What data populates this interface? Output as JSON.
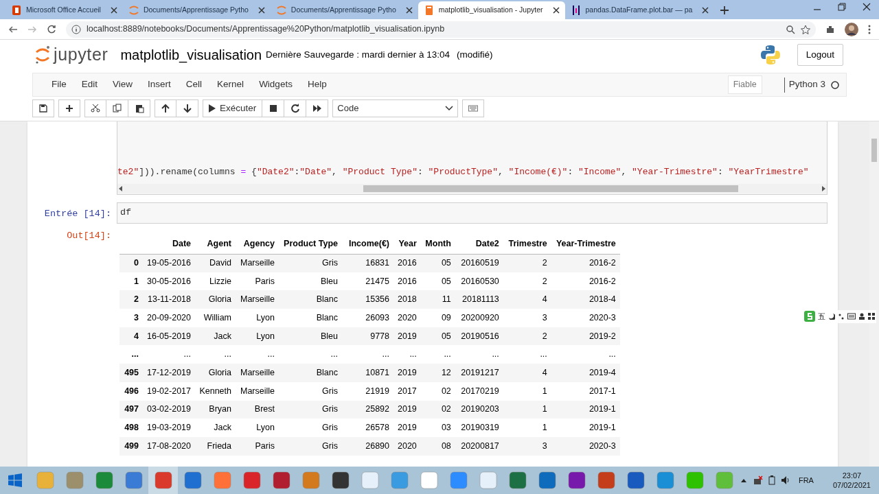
{
  "browser": {
    "tabs": [
      {
        "label": "Microsoft Office Accueil",
        "selected": false,
        "kind": "office"
      },
      {
        "label": "Documents/Apprentissage Pytho",
        "selected": false,
        "kind": "jupyter"
      },
      {
        "label": "Documents/Apprentissage Pytho",
        "selected": false,
        "kind": "jupyter"
      },
      {
        "label": "matplotlib_visualisation - Jupyter",
        "selected": true,
        "kind": "notebook"
      },
      {
        "label": "pandas.DataFrame.plot.bar — pa",
        "selected": false,
        "kind": "pandas"
      }
    ],
    "url": "localhost:8889/notebooks/Documents/Apprentissage%20Python/matplotlib_visualisation.ipynb"
  },
  "header": {
    "logo": "jupyter",
    "notebook_name": "matplotlib_visualisation",
    "checkpoint": "Dernière Sauvegarde : mardi dernier à 13:04",
    "modified": "(modifié)",
    "logout": "Logout"
  },
  "menu": [
    "File",
    "Edit",
    "View",
    "Insert",
    "Cell",
    "Kernel",
    "Widgets",
    "Help"
  ],
  "trusted": "Fiable",
  "kernel": "Python 3",
  "toolbar": {
    "run": "Exécuter",
    "cell_type": "Code"
  },
  "cells": [
    {
      "kind": "code_tail",
      "tokens": [
        {
          "text": "te2\"",
          "kind": "string"
        },
        {
          "text": "])).rename(columns ",
          "kind": "plain"
        },
        {
          "text": "=",
          "kind": "operator"
        },
        {
          "text": " {",
          "kind": "plain"
        },
        {
          "text": "\"Date2\"",
          "kind": "string"
        },
        {
          "text": ":",
          "kind": "plain"
        },
        {
          "text": "\"Date\"",
          "kind": "string"
        },
        {
          "text": ", ",
          "kind": "plain"
        },
        {
          "text": "\"Product Type\"",
          "kind": "string"
        },
        {
          "text": ": ",
          "kind": "plain"
        },
        {
          "text": "\"ProductType\"",
          "kind": "string"
        },
        {
          "text": ", ",
          "kind": "plain"
        },
        {
          "text": "\"Income(€)\"",
          "kind": "string"
        },
        {
          "text": ": ",
          "kind": "plain"
        },
        {
          "text": "\"Income\"",
          "kind": "string"
        },
        {
          "text": ", ",
          "kind": "plain"
        },
        {
          "text": "\"Year-Trimestre\"",
          "kind": "string"
        },
        {
          "text": ": ",
          "kind": "plain"
        },
        {
          "text": "\"YearTrimestre\"",
          "kind": "string"
        }
      ]
    },
    {
      "kind": "code",
      "prompt": "Entrée [14]:",
      "source": "df"
    },
    {
      "kind": "output",
      "prompt": "Out[14]:",
      "table": {
        "columns": [
          "",
          "Date",
          "Agent",
          "Agency",
          "Product Type",
          "Income(€)",
          "Year",
          "Month",
          "Date2",
          "Trimestre",
          "Year-Trimestre"
        ],
        "rows": [
          [
            "0",
            "19-05-2016",
            "David",
            "Marseille",
            "Gris",
            "16831",
            "2016",
            "05",
            "20160519",
            "2",
            "2016-2"
          ],
          [
            "1",
            "30-05-2016",
            "Lizzie",
            "Paris",
            "Bleu",
            "21475",
            "2016",
            "05",
            "20160530",
            "2",
            "2016-2"
          ],
          [
            "2",
            "13-11-2018",
            "Gloria",
            "Marseille",
            "Blanc",
            "15356",
            "2018",
            "11",
            "20181113",
            "4",
            "2018-4"
          ],
          [
            "3",
            "20-09-2020",
            "William",
            "Lyon",
            "Blanc",
            "26093",
            "2020",
            "09",
            "20200920",
            "3",
            "2020-3"
          ],
          [
            "4",
            "16-05-2019",
            "Jack",
            "Lyon",
            "Bleu",
            "9778",
            "2019",
            "05",
            "20190516",
            "2",
            "2019-2"
          ],
          [
            "...",
            "...",
            "...",
            "...",
            "...",
            "...",
            "...",
            "...",
            "...",
            "...",
            "..."
          ],
          [
            "495",
            "17-12-2019",
            "Gloria",
            "Marseille",
            "Blanc",
            "10871",
            "2019",
            "12",
            "20191217",
            "4",
            "2019-4"
          ],
          [
            "496",
            "19-02-2017",
            "Kenneth",
            "Marseille",
            "Gris",
            "21919",
            "2017",
            "02",
            "20170219",
            "1",
            "2017-1"
          ],
          [
            "497",
            "03-02-2019",
            "Bryan",
            "Brest",
            "Gris",
            "25892",
            "2019",
            "02",
            "20190203",
            "1",
            "2019-1"
          ],
          [
            "498",
            "19-03-2019",
            "Jack",
            "Lyon",
            "Gris",
            "26578",
            "2019",
            "03",
            "20190319",
            "1",
            "2019-1"
          ],
          [
            "499",
            "17-08-2020",
            "Frieda",
            "Paris",
            "Gris",
            "26890",
            "2020",
            "08",
            "20200817",
            "3",
            "2020-3"
          ]
        ]
      }
    }
  ],
  "ime": {
    "label": "五"
  },
  "taskbar": {
    "apps": [
      {
        "color": "#e8b23a",
        "selected": false
      },
      {
        "color": "#9c8f6b",
        "selected": false
      },
      {
        "color": "#1b8a3a",
        "selected": false
      },
      {
        "color": "#3a7bd5",
        "selected": false
      },
      {
        "color": "#d93a2b",
        "selected": true
      },
      {
        "color": "#1f6fd1",
        "selected": false
      },
      {
        "color": "#ff7139",
        "selected": false
      },
      {
        "color": "#d9252a",
        "selected": false
      },
      {
        "color": "#b01e2f",
        "selected": false
      },
      {
        "color": "#d47a1e",
        "selected": false
      },
      {
        "color": "#333333",
        "selected": false
      },
      {
        "color": "#e6f0fa",
        "selected": false
      },
      {
        "color": "#3b9be0",
        "selected": false
      },
      {
        "color": "#ffffff",
        "selected": false
      },
      {
        "color": "#2d8cff",
        "selected": false
      },
      {
        "color": "#e6f0fa",
        "selected": false
      },
      {
        "color": "#1d7044",
        "selected": false
      },
      {
        "color": "#0f6cbd",
        "selected": false
      },
      {
        "color": "#7719aa",
        "selected": false
      },
      {
        "color": "#c43e1c",
        "selected": false
      },
      {
        "color": "#185abd",
        "selected": false
      },
      {
        "color": "#1a8fd6",
        "selected": false
      },
      {
        "color": "#2dc100",
        "selected": false
      },
      {
        "color": "#5fbf3a",
        "selected": false
      }
    ],
    "lang": "FRA",
    "time": "23:07",
    "date": "07/02/2021"
  }
}
